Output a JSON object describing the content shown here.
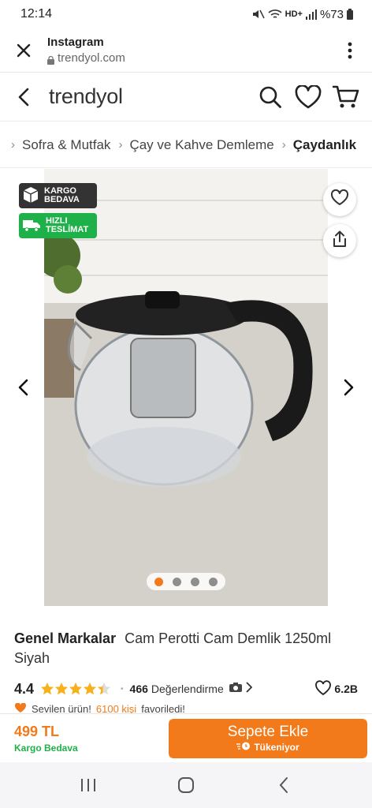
{
  "status_bar": {
    "time": "12:14",
    "network": "HD+",
    "battery": "%73"
  },
  "browser": {
    "title": "Instagram",
    "url": "trendyol.com",
    "icons": [
      "close-icon",
      "lock-icon",
      "more-vertical-icon"
    ]
  },
  "header": {
    "logo": "trendyol",
    "icons": [
      "back-arrow-icon",
      "search-icon",
      "heart-icon",
      "cart-icon"
    ]
  },
  "breadcrumb": {
    "items": [
      {
        "label": "Sofra & Mutfak"
      },
      {
        "label": "Çay ve Kahve Demleme"
      },
      {
        "label": "Çaydanlık"
      }
    ]
  },
  "gallery": {
    "badges": [
      {
        "line1": "KARGO",
        "line2": "BEDAVA",
        "color": "#333333",
        "icon": "box-icon"
      },
      {
        "line1": "HIZLI",
        "line2": "TESLİMAT",
        "color": "#1fb149",
        "icon": "truck-icon"
      }
    ],
    "slide_count": 4,
    "active_slide": 1,
    "accent": "#f27a1a"
  },
  "product": {
    "brand": "Genel Markalar",
    "name": "Cam Perotti Cam Demlik 1250ml Siyah",
    "rating": "4.4",
    "rating_stars": 4.4,
    "review_count": "466",
    "review_label": "Değerlendirme",
    "favorite_count": "6.2B",
    "social_text": "Sevilen ürün!",
    "social_highlight": "6100 kişi",
    "social_suffix": "favoriledi!"
  },
  "buy_bar": {
    "price": "499 TL",
    "shipping": "Kargo Bedava",
    "button_label": "Sepete Ekle",
    "stock_label": "Tükeniyor"
  },
  "nav_bar": {
    "icons": [
      "recent-apps-icon",
      "home-icon",
      "back-icon"
    ]
  }
}
